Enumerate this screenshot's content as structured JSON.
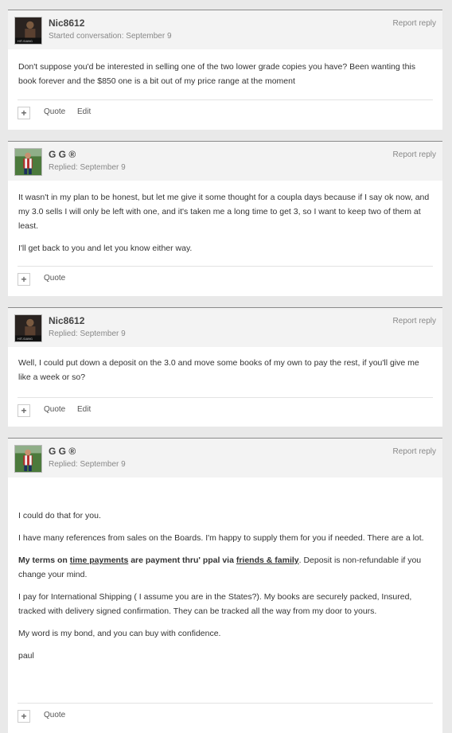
{
  "posts": [
    {
      "author": "Nic8612",
      "meta": "Started conversation: September 9",
      "report": "Report reply",
      "paragraphs": [
        "Don't suppose you'd be interested in selling one of the two lower grade copies you have? Been wanting this book forever and the $850 one is a bit out of my price range at the moment"
      ],
      "actions": {
        "plus": "+",
        "quote": "Quote",
        "edit": "Edit"
      }
    },
    {
      "author": "G G ®",
      "meta": "Replied: September 9",
      "report": "Report reply",
      "paragraphs": [
        "It wasn't in my plan to be honest, but let me give it some thought for a coupla days because if I say ok now, and my 3.0 sells I will only be left with one, and it's taken me a long time to get 3, so I want to keep two of them at least.",
        "I'll get back to you and let you know either way."
      ],
      "actions": {
        "plus": "+",
        "quote": "Quote"
      }
    },
    {
      "author": "Nic8612",
      "meta": "Replied: September 9",
      "report": "Report reply",
      "paragraphs": [
        "Well, I could put down a deposit on the 3.0 and move some books of my own to pay the rest, if you'll give me like a week or so?"
      ],
      "actions": {
        "plus": "+",
        "quote": "Quote",
        "edit": "Edit"
      }
    },
    {
      "author": "G G ®",
      "meta": "Replied: September 9",
      "report": "Report reply",
      "paragraphs": [
        "I could do that for you.",
        "I have many references from sales on the Boards. I'm happy to supply them for you if needed. There are a lot.",
        "I pay for International Shipping ( I assume you are in the States?). My books are securely packed, Insured, tracked with delivery signed confirmation. They can be tracked all the way from my door to yours.",
        "My word is my bond, and you can buy with confidence.",
        "paul"
      ],
      "terms": {
        "t1": "My terms on ",
        "t2": "time payments",
        "t3": " are payment thru' ppal via ",
        "t4": "friends & family",
        "t5": ". Deposit is non-refundable if you change your mind."
      },
      "actions": {
        "plus": "+",
        "quote": "Quote"
      }
    }
  ]
}
